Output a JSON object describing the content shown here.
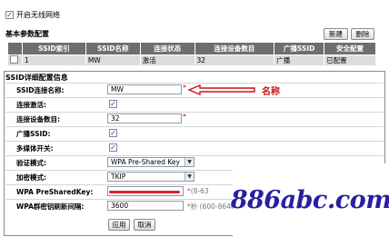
{
  "enable_wireless": {
    "label": "开启无线网络",
    "checked": "✓"
  },
  "basic": {
    "title": "基本参数配置",
    "new_label": "新建",
    "delete_label": "删除",
    "columns": [
      "",
      "SSID索引",
      "SSID名称",
      "连接状态",
      "连接设备数目",
      "广播SSID",
      "安全配置"
    ],
    "row": {
      "index": "1",
      "name": "MW",
      "status": "激活",
      "devices": "32",
      "broadcast": "广播",
      "security": "已配置"
    }
  },
  "detail": {
    "title": "SSID详细配置信息",
    "ssid_name_label": "SSID连接名称:",
    "ssid_name_value": "MW",
    "ssid_name_star": "*",
    "annotation": "名称",
    "connect_active_label": "连接激活:",
    "device_count_label": "连接设备数目:",
    "device_count_value": "32",
    "device_count_star": "*",
    "broadcast_label": "广播SSID:",
    "multimedia_label": "多媒体开关:",
    "auth_label": "验证模式:",
    "auth_value": "WPA Pre-Shared Key",
    "encrypt_label": "加密模式:",
    "encrypt_value": "TKIP",
    "psk_label": "WPA PreSharedKey:",
    "psk_hint": "*(8-63",
    "rekey_label": "WPA群密钥刷新间隔:",
    "rekey_value": "3600",
    "rekey_hint": "*秒 (600-8640",
    "apply_label": "应用",
    "cancel_label": "取消"
  },
  "watermark": "886abc.com",
  "colors": {
    "header_bg": "#6e6e6e",
    "row_bg": "#dcdcdc",
    "annotation": "#d01010",
    "watermark": "#2a1fa0"
  }
}
